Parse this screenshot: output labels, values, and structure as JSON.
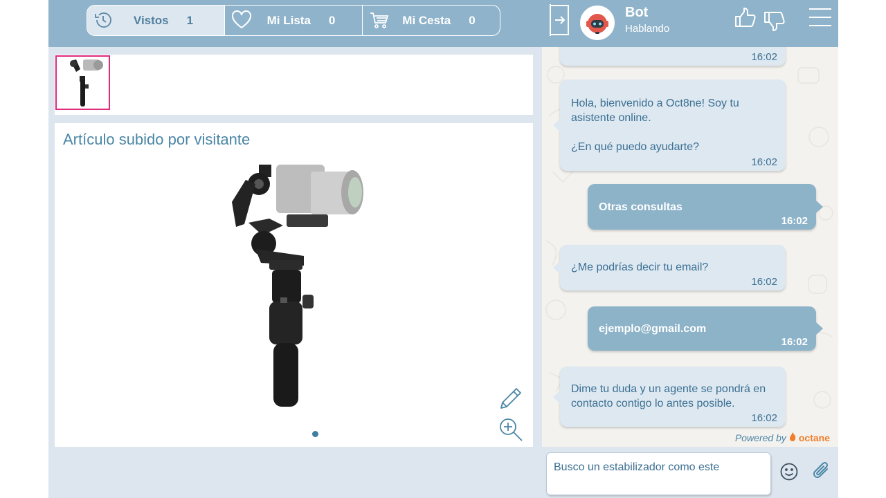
{
  "tabs": [
    {
      "label": "Vistos",
      "count": "1",
      "icon": "history-icon"
    },
    {
      "label": "Mi Lista",
      "count": "0",
      "icon": "heart-icon"
    },
    {
      "label": "Mi Cesta",
      "count": "0",
      "icon": "cart-icon"
    }
  ],
  "chat_header": {
    "bot_name": "Bot",
    "bot_status": "Hablando"
  },
  "viewer": {
    "title": "Artículo subido por visitante"
  },
  "messages": [
    {
      "from": "bot",
      "text": "",
      "time": "16:02"
    },
    {
      "from": "bot",
      "text": "Hola, bienvenido a Oct8ne! Soy tu asistente online.\n\n¿En qué puedo ayudarte?",
      "time": "16:02"
    },
    {
      "from": "user",
      "text": "Otras consultas",
      "time": "16:02"
    },
    {
      "from": "bot",
      "text": "¿Me podrías decir tu email?",
      "time": "16:02"
    },
    {
      "from": "user",
      "text": "ejemplo@gmail.com",
      "time": "16:02"
    },
    {
      "from": "bot",
      "text": "Dime tu duda y un agente se pondrá en contacto contigo lo antes posible.",
      "time": "16:02"
    }
  ],
  "powered": {
    "label": "Powered by",
    "brand": "octane"
  },
  "input": {
    "value": "Busco un estabilizador como este"
  },
  "colors": {
    "header": "#8fb3ca",
    "accent": "#4a86a6",
    "thumb_border": "#e02b7d",
    "bot_bubble": "#dde8f1",
    "user_bubble": "#8db3c9"
  }
}
